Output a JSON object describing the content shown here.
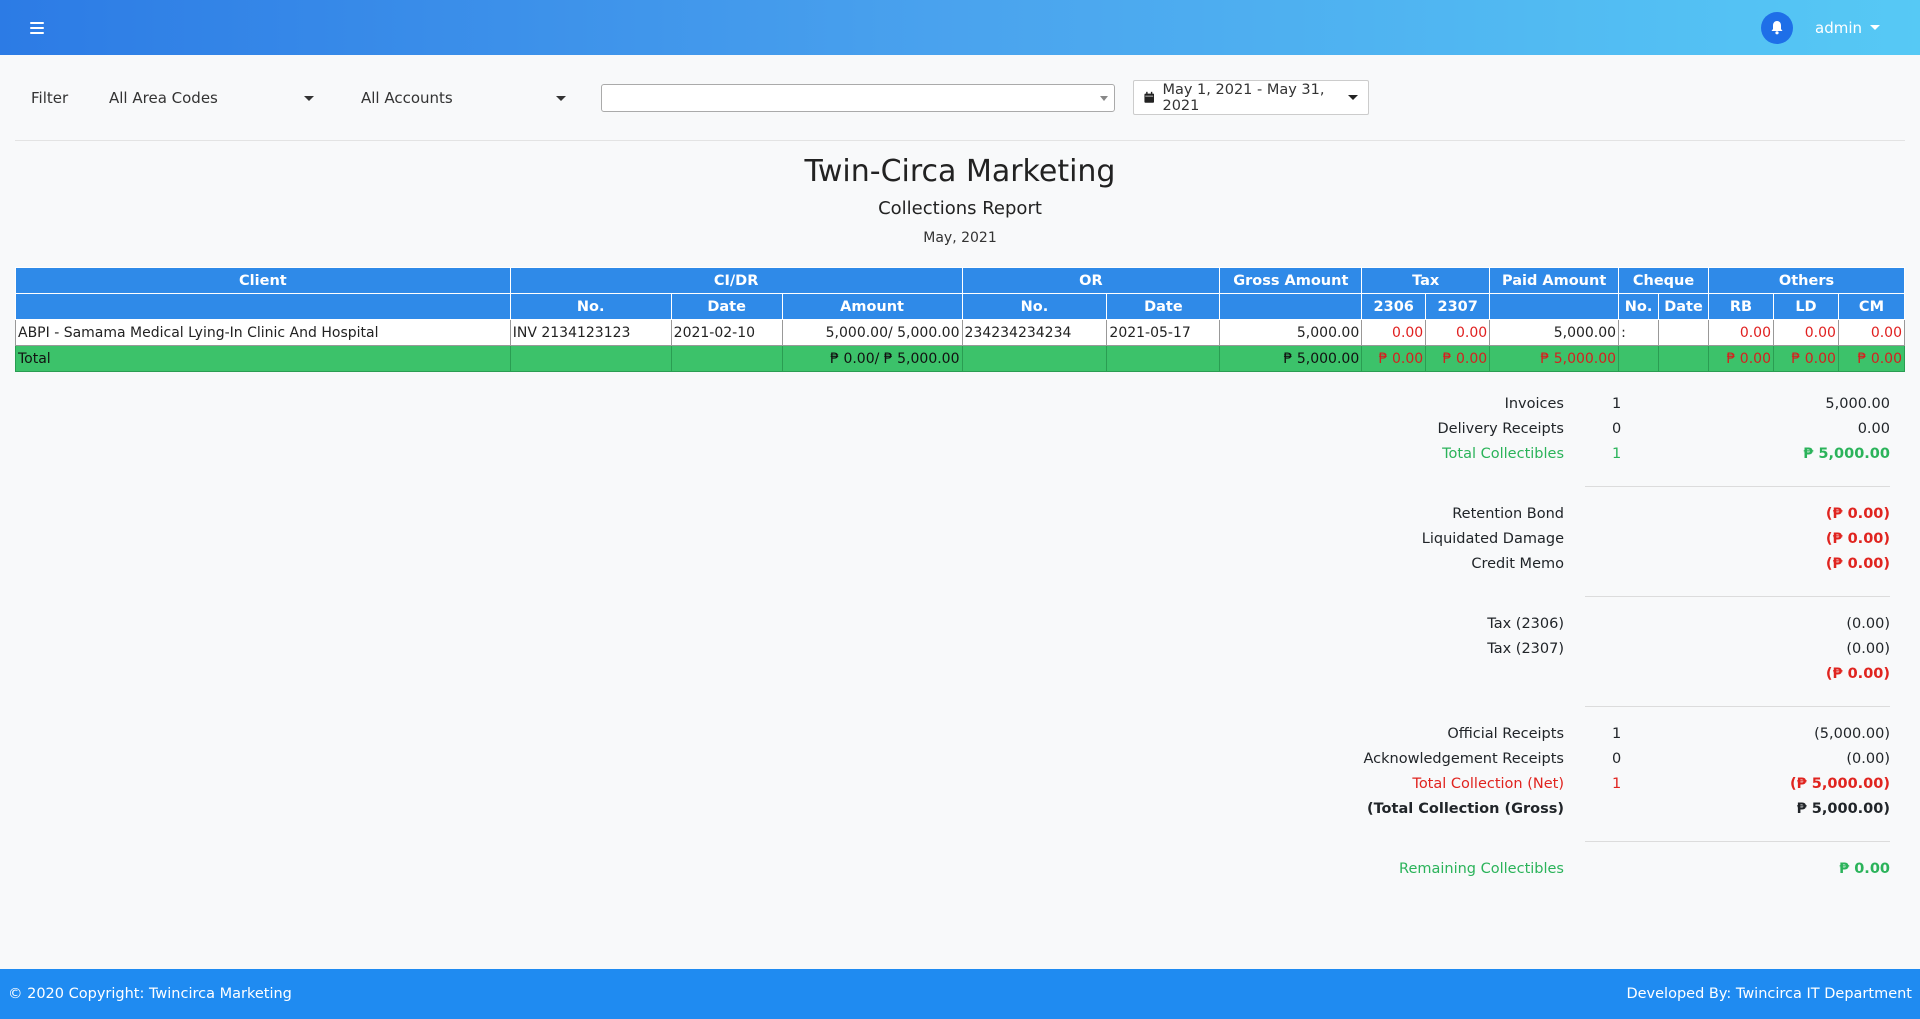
{
  "navbar": {
    "user_label": "admin",
    "accent": "#2c7be5"
  },
  "filter": {
    "label": "Filter",
    "area_codes": "All Area Codes",
    "accounts": "All Accounts",
    "client_select_value": "",
    "date_range": "May 1, 2021 - May 31, 2021"
  },
  "report": {
    "company": "Twin-Circa Marketing",
    "title": "Collections Report",
    "period": "May, 2021"
  },
  "table": {
    "group_headers": {
      "client": "Client",
      "cidr": "CI/DR",
      "or": "OR",
      "gross": "Gross Amount",
      "tax": "Tax",
      "paid": "Paid Amount",
      "cheque": "Cheque",
      "others": "Others"
    },
    "sub_headers": {
      "cidr_no": "No.",
      "cidr_date": "Date",
      "cidr_amount": "Amount",
      "or_no": "No.",
      "or_date": "Date",
      "tax_2306": "2306",
      "tax_2307": "2307",
      "cheque_no": "No.",
      "cheque_date": "Date",
      "rb": "RB",
      "ld": "LD",
      "cm": "CM"
    },
    "row": {
      "client": "ABPI - Samama Medical Lying-In Clinic And Hospital",
      "cidr_no": "INV 2134123123",
      "cidr_date": "2021-02-10",
      "cidr_amount": "5,000.00/ 5,000.00",
      "or_no": "234234234234",
      "or_date": "2021-05-17",
      "gross": "5,000.00",
      "tax_2306": "0.00",
      "tax_2307": "0.00",
      "paid": "5,000.00",
      "cheque_no": ":",
      "cheque_date": "",
      "rb": "0.00",
      "ld": "0.00",
      "cm": "0.00"
    },
    "total": {
      "label": "Total",
      "cidr_amount": "₱ 0.00/ ₱ 5,000.00",
      "gross": "₱ 5,000.00",
      "tax_2306": "₱ 0.00",
      "tax_2307": "₱ 0.00",
      "paid": "₱ 5,000.00",
      "rb": "₱ 0.00",
      "ld": "₱ 0.00",
      "cm": "₱ 0.00"
    }
  },
  "summary": {
    "invoices": {
      "label": "Invoices",
      "count": "1",
      "value": "5,000.00"
    },
    "delivery_receipts": {
      "label": "Delivery Receipts",
      "count": "0",
      "value": "0.00"
    },
    "total_collectibles": {
      "label": "Total Collectibles",
      "count": "1",
      "value": "₱ 5,000.00"
    },
    "retention_bond": {
      "label": "Retention Bond",
      "value": "(₱ 0.00)"
    },
    "liquidated_damage": {
      "label": "Liquidated Damage",
      "value": "(₱ 0.00)"
    },
    "credit_memo": {
      "label": "Credit Memo",
      "value": "(₱ 0.00)"
    },
    "tax_2306": {
      "label": "Tax (2306)",
      "value": "(0.00)"
    },
    "tax_2307": {
      "label": "Tax (2307)",
      "value": "(0.00)"
    },
    "tax_total": {
      "value": "(₱ 0.00)"
    },
    "official_receipts": {
      "label": "Official Receipts",
      "count": "1",
      "value": "(5,000.00)"
    },
    "ack_receipts": {
      "label": "Acknowledgement Receipts",
      "count": "0",
      "value": "(0.00)"
    },
    "total_net": {
      "label": "Total Collection (Net)",
      "count": "1",
      "value": "(₱ 5,000.00)"
    },
    "total_gross": {
      "label": "(Total Collection (Gross)",
      "value": "₱ 5,000.00)"
    },
    "remaining": {
      "label": "Remaining Collectibles",
      "value": "₱ 0.00"
    }
  },
  "footer": {
    "copyright": "© 2020 Copyright: Twincirca Marketing",
    "developer": "Developed By: Twincirca IT Department"
  }
}
